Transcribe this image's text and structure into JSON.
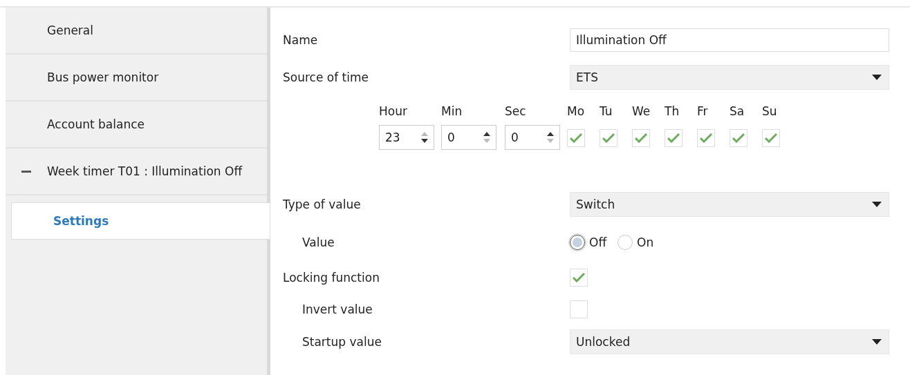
{
  "sidebar": {
    "items": [
      {
        "label": "General",
        "selected": false,
        "expanded": false
      },
      {
        "label": "Bus power monitor",
        "selected": false,
        "expanded": false
      },
      {
        "label": "Account balance",
        "selected": false,
        "expanded": false
      },
      {
        "label": "Week timer T01 : Illumination Off",
        "selected": false,
        "expanded": true,
        "children": [
          {
            "label": "Settings",
            "selected": true
          }
        ]
      }
    ]
  },
  "form": {
    "rows": [
      {
        "kind": "text",
        "label": "Name",
        "value": "Illumination Off"
      },
      {
        "kind": "select",
        "label": "Source of time",
        "value": "ETS"
      },
      {
        "kind": "time",
        "spinners": [
          {
            "label": "Hour",
            "value": "23",
            "up_enabled": false,
            "down_enabled": true
          },
          {
            "label": "Min",
            "value": "0",
            "up_enabled": true,
            "down_enabled": false
          },
          {
            "label": "Sec",
            "value": "0",
            "up_enabled": true,
            "down_enabled": false
          }
        ],
        "days": [
          {
            "label": "Mo",
            "checked": true
          },
          {
            "label": "Tu",
            "checked": true
          },
          {
            "label": "We",
            "checked": true
          },
          {
            "label": "Th",
            "checked": true
          },
          {
            "label": "Fr",
            "checked": true
          },
          {
            "label": "Sa",
            "checked": true
          },
          {
            "label": "Su",
            "checked": true
          }
        ]
      },
      {
        "kind": "select",
        "label": "Type of value",
        "value": "Switch",
        "children": [
          {
            "kind": "radio",
            "label": "Value",
            "options": [
              {
                "label": "Off",
                "selected": true
              },
              {
                "label": "On",
                "selected": false
              }
            ]
          }
        ]
      },
      {
        "kind": "checkbox",
        "label": "Locking function",
        "checked": true,
        "children": [
          {
            "kind": "checkbox",
            "label": "Invert value",
            "checked": false
          },
          {
            "kind": "select",
            "label": "Startup value",
            "value": "Unlocked"
          }
        ]
      }
    ]
  }
}
